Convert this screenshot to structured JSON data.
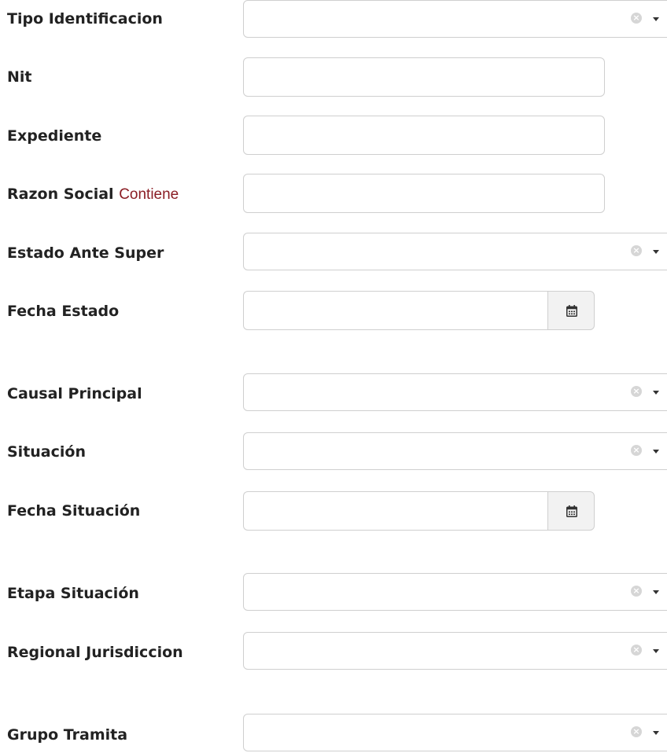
{
  "form": {
    "tipo_identificacion": {
      "label": "Tipo Identificacion",
      "value": "",
      "clear_icon": "clear-circle-icon",
      "caret_icon": "caret-down-icon"
    },
    "nit": {
      "label": "Nit",
      "value": "",
      "placeholder": ""
    },
    "expediente": {
      "label": "Expediente",
      "value": "",
      "placeholder": ""
    },
    "razon_social": {
      "label": "Razon Social",
      "hint": "Contiene",
      "value": "",
      "placeholder": ""
    },
    "estado_ante_super": {
      "label": "Estado Ante Super",
      "value": ""
    },
    "fecha_estado": {
      "label": "Fecha Estado",
      "value": "",
      "placeholder": "",
      "icon": "calendar-icon"
    },
    "causal_principal": {
      "label": "Causal Principal",
      "value": ""
    },
    "situacion": {
      "label": "Situación",
      "value": ""
    },
    "fecha_situacion": {
      "label": "Fecha Situación",
      "value": "",
      "placeholder": "",
      "icon": "calendar-icon"
    },
    "etapa_situacion": {
      "label": "Etapa Situación",
      "value": ""
    },
    "regional_jurisdiccion": {
      "label": "Regional Jurisdiccion",
      "value": ""
    },
    "grupo_tramita": {
      "label": "Grupo Tramita",
      "value": ""
    }
  },
  "colors": {
    "label": "#222222",
    "hint": "#8a1d24",
    "border": "#cfcfcf",
    "addon_bg": "#f2f2f2",
    "clear_icon": "#d6d6d6"
  }
}
